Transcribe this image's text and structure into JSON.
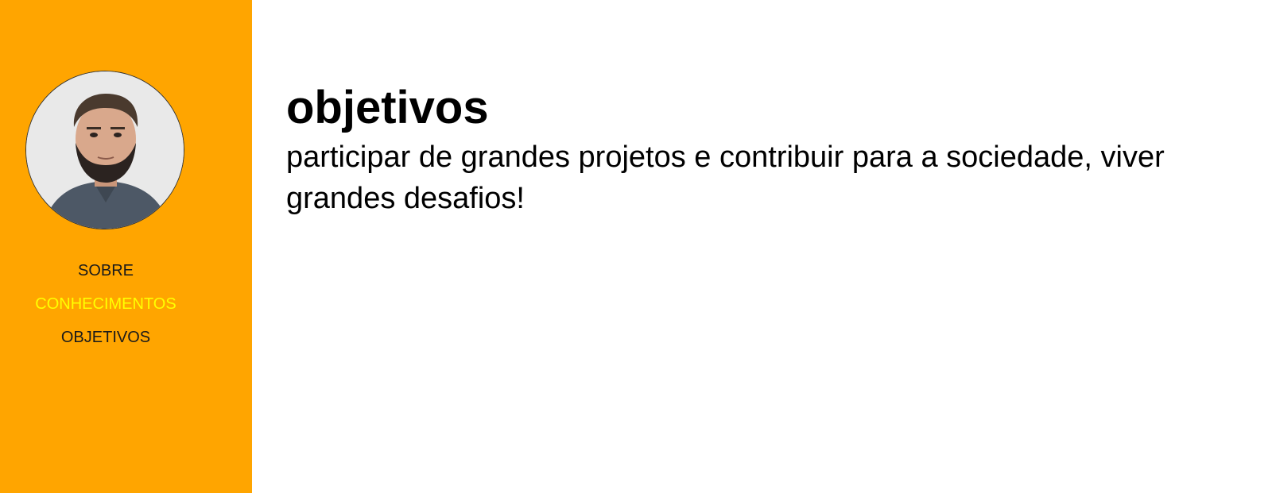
{
  "sidebar": {
    "avatar_icon": "profile-photo",
    "nav": [
      {
        "label": "SOBRE",
        "active": false
      },
      {
        "label": "CONHECIMENTOS",
        "active": true
      },
      {
        "label": "OBJETIVOS",
        "active": false
      }
    ]
  },
  "main": {
    "title": "objetivos",
    "text": "participar de grandes projetos e contribuir para a sociedade, viver grandes desafios!"
  },
  "colors": {
    "sidebar_bg": "#ffa500",
    "nav_active": "#ffff00",
    "nav_default": "#1a1a1a"
  }
}
